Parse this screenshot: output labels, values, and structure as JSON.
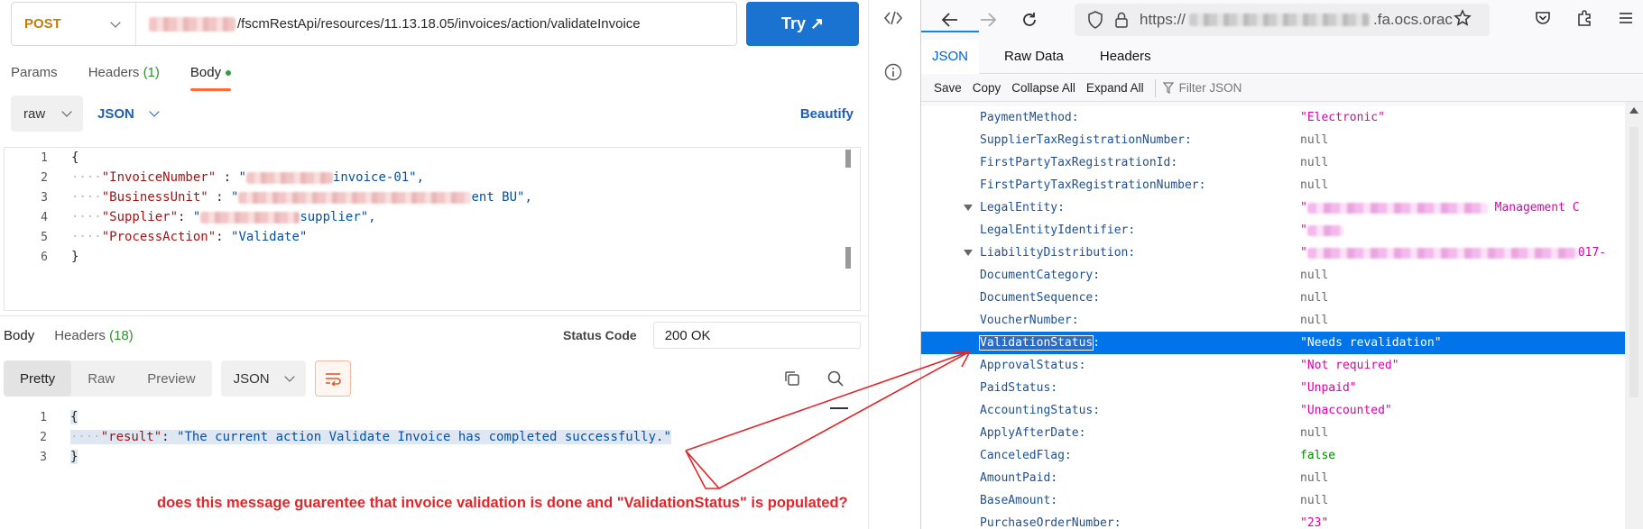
{
  "left": {
    "method": "POST",
    "url_path": "/fscmRestApi/resources/11.13.18.05/invoices/action/validateInvoice",
    "try_label": "Try ↗",
    "request_tabs": [
      {
        "label": "Params"
      },
      {
        "label": "Headers",
        "count": "(1)"
      },
      {
        "label": "Body"
      }
    ],
    "body_mode": "raw",
    "body_format": "JSON",
    "beautify_label": "Beautify",
    "request_lines": [
      {
        "n": "1",
        "text": "{"
      },
      {
        "n": "2",
        "key": "\"InvoiceNumber\"",
        "sep": " : ",
        "val": "invoice-01\","
      },
      {
        "n": "3",
        "key": "\"BusinessUnit\"",
        "sep": " : ",
        "val": "ent BU\","
      },
      {
        "n": "4",
        "key": "\"Supplier\"",
        "sep": ": ",
        "val": "supplier\","
      },
      {
        "n": "5",
        "key": "\"ProcessAction\"",
        "sep": ": ",
        "val": "\"Validate\""
      },
      {
        "n": "6",
        "text": "}"
      }
    ],
    "response_tabs": [
      {
        "label": "Body"
      },
      {
        "label": "Headers",
        "count": "(18)"
      }
    ],
    "status_label": "Status Code",
    "status_value": "200 OK",
    "view_modes": [
      "Pretty",
      "Raw",
      "Preview"
    ],
    "response_format": "JSON",
    "response_lines": [
      {
        "n": "1",
        "text": "{"
      },
      {
        "n": "2",
        "key": "\"result\"",
        "sep": ": ",
        "val": "\"The current action Validate Invoice has completed successfully.\""
      },
      {
        "n": "3",
        "text": "}"
      }
    ],
    "annotation": "does this message guarentee that invoice validation is done and \"ValidationStatus\" is populated?"
  },
  "browser": {
    "url_prefix": "https://",
    "url_suffix": ".fa.ocs.orac",
    "viewer_tabs": [
      "JSON",
      "Raw Data",
      "Headers"
    ],
    "toolbar_buttons": [
      "Save",
      "Copy",
      "Collapse All",
      "Expand All"
    ],
    "filter_placeholder": "Filter JSON",
    "rows": [
      {
        "key": "PaymentMethod:",
        "val": "\"Electronic\"",
        "type": "str"
      },
      {
        "key": "SupplierTaxRegistrationNumber:",
        "val": "null",
        "type": "null"
      },
      {
        "key": "FirstPartyTaxRegistrationId:",
        "val": "null",
        "type": "null"
      },
      {
        "key": "FirstPartyTaxRegistrationNumber:",
        "val": "null",
        "type": "null"
      },
      {
        "key": "LegalEntity:",
        "val": "\"",
        "tail": " Management C",
        "type": "str",
        "expand": true,
        "blur": 200
      },
      {
        "key": "LegalEntityIdentifier:",
        "val": "\"",
        "type": "str",
        "blur": 40
      },
      {
        "key": "LiabilityDistribution:",
        "val": "\"",
        "tail": "017-",
        "type": "str",
        "expand": true,
        "blur": 300
      },
      {
        "key": "DocumentCategory:",
        "val": "null",
        "type": "null"
      },
      {
        "key": "DocumentSequence:",
        "val": "null",
        "type": "null"
      },
      {
        "key": "VoucherNumber:",
        "val": "null",
        "type": "null"
      },
      {
        "key": "ValidationStatus",
        "suffix": ":",
        "val": "\"Needs revalidation\"",
        "type": "str",
        "selected": true
      },
      {
        "key": "ApprovalStatus:",
        "val": "\"Not required\"",
        "type": "str"
      },
      {
        "key": "PaidStatus:",
        "val": "\"Unpaid\"",
        "type": "str"
      },
      {
        "key": "AccountingStatus:",
        "val": "\"Unaccounted\"",
        "type": "str"
      },
      {
        "key": "ApplyAfterDate:",
        "val": "null",
        "type": "null"
      },
      {
        "key": "CanceledFlag:",
        "val": "false",
        "type": "bool"
      },
      {
        "key": "AmountPaid:",
        "val": "null",
        "type": "null"
      },
      {
        "key": "BaseAmount:",
        "val": "null",
        "type": "null"
      },
      {
        "key": "PurchaseOrderNumber:",
        "val": "\"23\"",
        "type": "str"
      }
    ]
  },
  "colors": {
    "method": "#c27c0e",
    "accent": "#1a73d1",
    "tab_underline": "#ff6c37",
    "annotation": "#e0262b",
    "json_key": "#1d4f91",
    "json_string": "#dd00a9",
    "selected_row": "#0074e8"
  }
}
